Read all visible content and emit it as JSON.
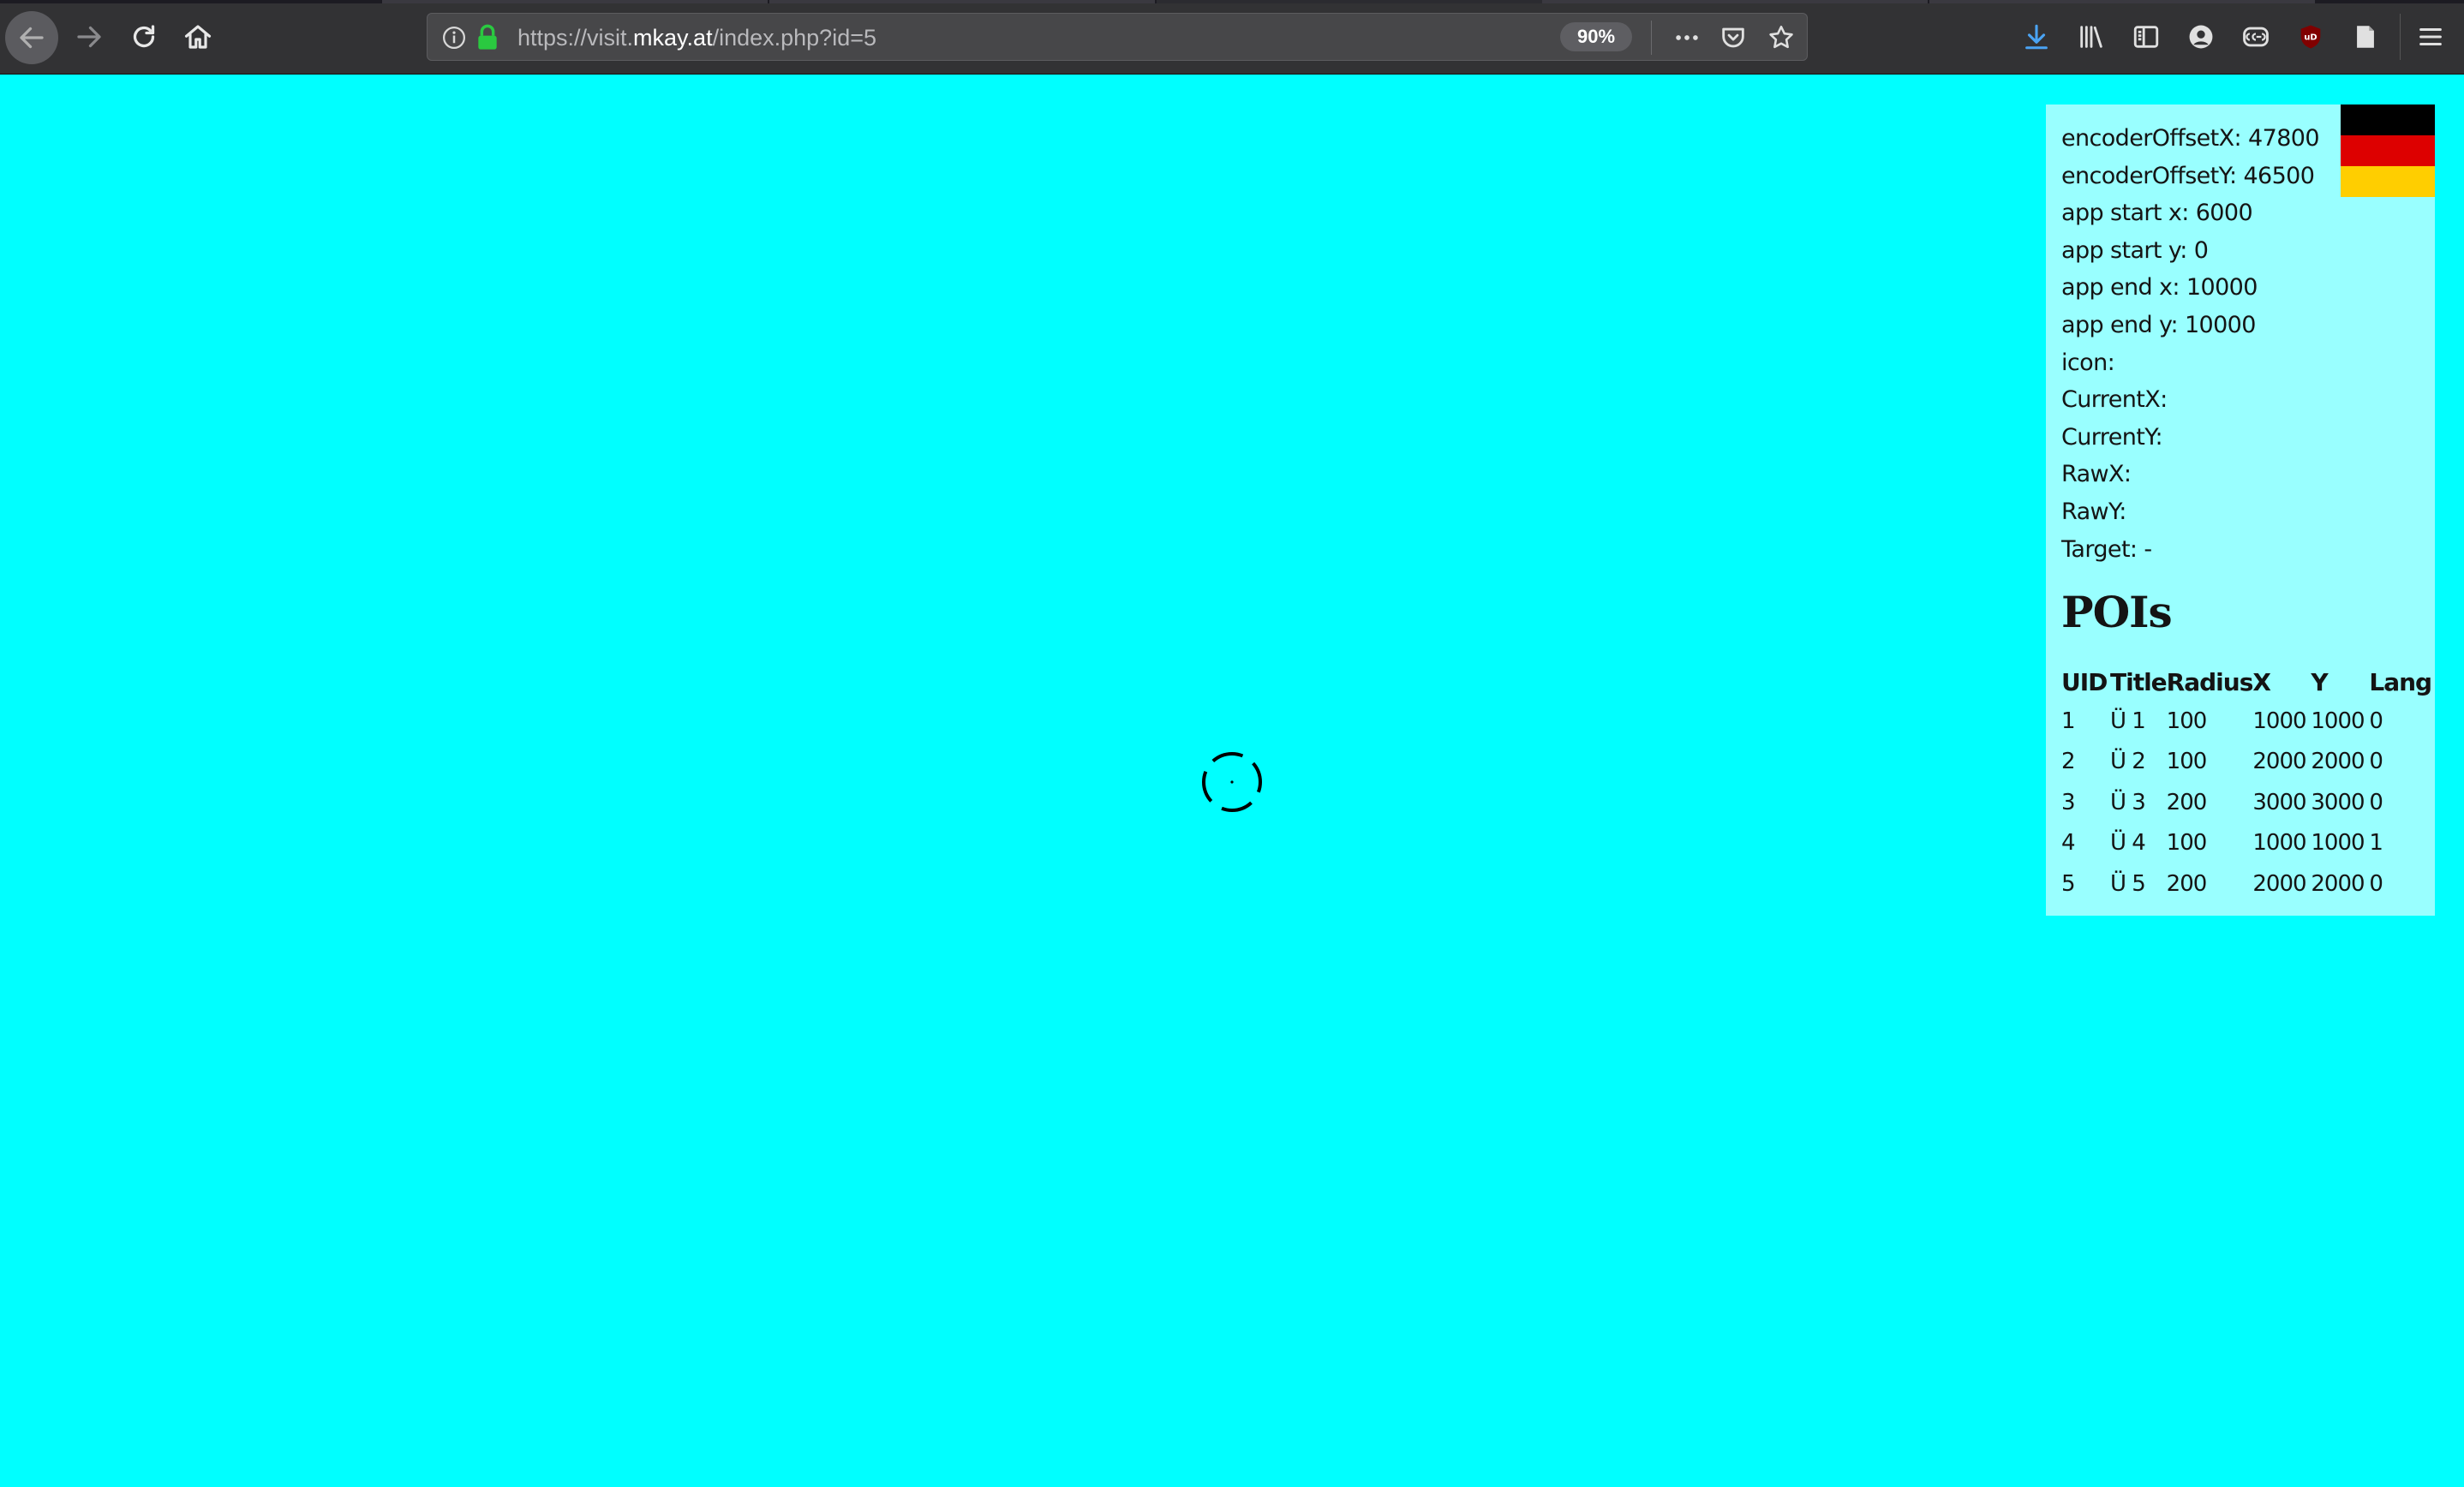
{
  "browser": {
    "url_prefix": "https://visit.",
    "url_host": "mkay.at",
    "url_path": "/index.php?id=5",
    "zoom": "90%"
  },
  "icons": {
    "nav": [
      "back-icon",
      "forward-icon",
      "reload-icon",
      "home-icon"
    ],
    "url": [
      "info-icon",
      "lock-icon",
      "page-actions-icon",
      "pocket-icon",
      "bookmark-star-icon"
    ],
    "toolbar": [
      "download-icon",
      "library-icon",
      "sidebar-icon",
      "account-icon",
      "extension-icon",
      "ublock-icon",
      "reader-icon",
      "menu-icon"
    ]
  },
  "colors": {
    "page_background": "#00ffff",
    "panel_background": "#99ffff",
    "flag": [
      "#000000",
      "#dd0000",
      "#ffce00"
    ],
    "lock": "#2ac940",
    "download": "#4aa3f3",
    "ublock": "#800000"
  },
  "info": {
    "encoder_offset_x": "encoderOffsetX: 47800",
    "encoder_offset_y": "encoderOffsetY: 46500",
    "app_start_x": "app start x: 6000",
    "app_start_y": "app start y: 0",
    "app_end_x": "app end x: 10000",
    "app_end_y": "app end y: 10000",
    "icon": "icon:",
    "current_x": "CurrentX:",
    "current_y": "CurrentY:",
    "raw_x": "RawX:",
    "raw_y": "RawY:",
    "target": "Target: -"
  },
  "poi": {
    "heading": "POIs",
    "columns": [
      "UID",
      "Title",
      "Radius",
      "X",
      "Y",
      "Lang"
    ],
    "rows": [
      [
        "1",
        "Ü 1",
        "100",
        "1000",
        "1000",
        "0"
      ],
      [
        "2",
        "Ü 2",
        "100",
        "2000",
        "2000",
        "0"
      ],
      [
        "3",
        "Ü 3",
        "200",
        "3000",
        "3000",
        "0"
      ],
      [
        "4",
        "Ü 4",
        "100",
        "1000",
        "1000",
        "1"
      ],
      [
        "5",
        "Ü 5",
        "200",
        "2000",
        "2000",
        "0"
      ]
    ]
  }
}
